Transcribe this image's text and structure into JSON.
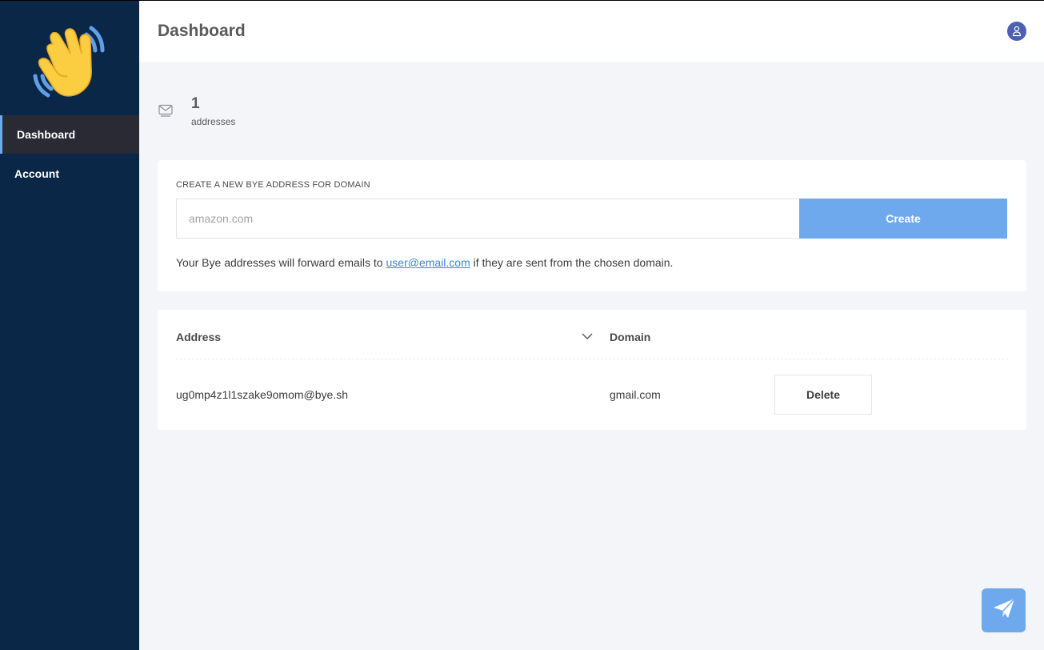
{
  "sidebar": {
    "logo_icon": "waving-hand-icon",
    "items": [
      {
        "label": "Dashboard",
        "active": true
      },
      {
        "label": "Account",
        "active": false
      }
    ]
  },
  "header": {
    "title": "Dashboard",
    "user_icon": "user-icon"
  },
  "stats": {
    "icon": "mail-icon",
    "value": "1",
    "label": "addresses"
  },
  "create_form": {
    "label": "CREATE A NEW BYE ADDRESS FOR DOMAIN",
    "input_placeholder": "amazon.com",
    "input_value": "",
    "button_label": "Create",
    "info_prefix": "Your Bye addresses will forward emails to",
    "info_email": "user@email.com",
    "info_suffix": "if they are sent from the chosen domain."
  },
  "table": {
    "columns": [
      "Address",
      "Domain"
    ],
    "rows": [
      {
        "address": "ug0mp4z1l1szake9omom@bye.sh",
        "domain": "gmail.com",
        "action_label": "Delete"
      }
    ]
  },
  "fab": {
    "icon": "paper-plane-icon"
  },
  "colors": {
    "sidebar_bg": "#0b2747",
    "accent": "#6ea9ee",
    "active_nav_bg": "#2a2a35",
    "avatar_bg": "#4c5fb0",
    "link": "#3a88d9"
  }
}
